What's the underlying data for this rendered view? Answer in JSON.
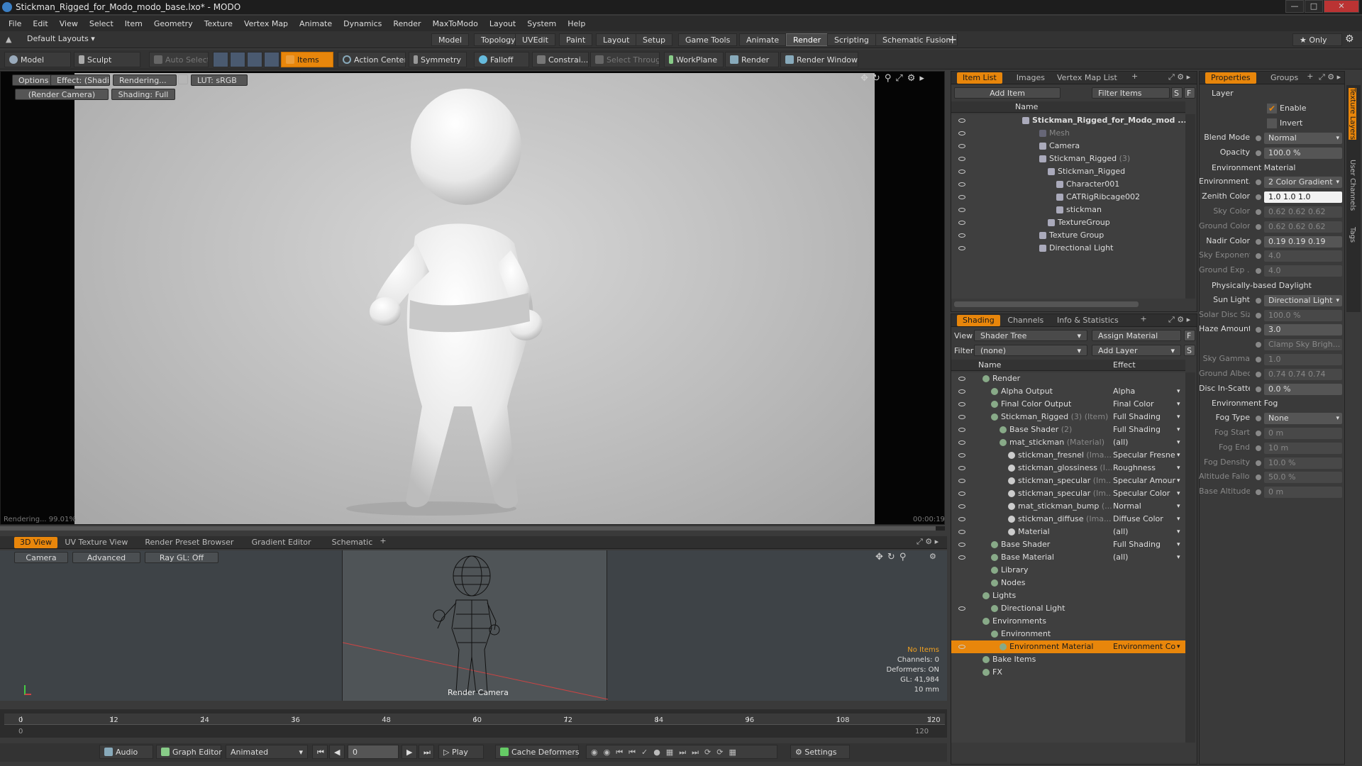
{
  "window": {
    "title": "Stickman_Rigged_for_Modo_modo_base.lxo* - MODO"
  },
  "menu": [
    "File",
    "Edit",
    "View",
    "Select",
    "Item",
    "Geometry",
    "Texture",
    "Vertex Map",
    "Animate",
    "Dynamics",
    "Render",
    "MaxToModo",
    "Layout",
    "System",
    "Help"
  ],
  "layouts": {
    "default": "Default Layouts ▾",
    "tabs": [
      "Model",
      "Topology",
      "UVEdit",
      "Paint",
      "Layout",
      "Setup",
      "Game Tools",
      "Animate",
      "Render",
      "Scripting",
      "Schematic Fusion"
    ],
    "active": "Render",
    "only": "★ Only"
  },
  "toolbar": {
    "model": "Model",
    "sculpt": "Sculpt",
    "auto_select": "Auto Select",
    "items": "Items",
    "action_center": "Action Center",
    "symmetry": "Symmetry",
    "falloff": "Falloff",
    "constrain": "Constrai...",
    "select_through": "Select Through",
    "workplane": "WorkPlane",
    "render": "Render",
    "render_window": "Render Window"
  },
  "viewport": {
    "options": "Options",
    "effect": "Effect: (Shadi...",
    "rendering": "Rendering...",
    "lut": "LUT: sRGB",
    "camera": "(Render Camera)",
    "shading": "Shading: Full",
    "status": "Rendering... 99.01%",
    "time": "00:00:19"
  },
  "lower_tabs": [
    "3D View",
    "UV Texture View",
    "Render Preset Browser",
    "Gradient Editor",
    "Schematic"
  ],
  "lower_view": {
    "camera": "Camera",
    "advanced": "Advanced",
    "raygl": "Ray GL: Off",
    "label": "Render Camera",
    "info": [
      "No Items",
      "Channels: 0",
      "Deformers: ON",
      "GL: 41,984",
      "10 mm"
    ]
  },
  "timeline": {
    "ticks": [
      "0",
      "12",
      "24",
      "36",
      "48",
      "60",
      "72",
      "84",
      "96",
      "108",
      "120"
    ],
    "sub": [
      "0",
      "120"
    ]
  },
  "bottom": {
    "audio": "Audio",
    "graph_editor": "Graph Editor",
    "animated": "Animated",
    "frame": "0",
    "play": "Play",
    "cache": "Cache Deformers",
    "settings": "Settings"
  },
  "item_list": {
    "tabs": [
      "Item List",
      "Images",
      "Vertex Map List"
    ],
    "add_item": "Add Item",
    "filter": "Filter Items",
    "s": "S",
    "f": "F",
    "col": "Name",
    "items": [
      {
        "t": "Stickman_Rigged_for_Modo_mod ...",
        "d": 0,
        "b": true
      },
      {
        "t": "Mesh",
        "d": 2,
        "g": true
      },
      {
        "t": "Camera",
        "d": 2
      },
      {
        "t": "Stickman_Rigged",
        "x": " (3)",
        "d": 2
      },
      {
        "t": "Stickman_Rigged",
        "d": 3
      },
      {
        "t": "Character001",
        "d": 4
      },
      {
        "t": "CATRigRibcage002",
        "d": 4
      },
      {
        "t": "stickman",
        "d": 4
      },
      {
        "t": "TextureGroup",
        "d": 3
      },
      {
        "t": "Texture Group",
        "d": 2
      },
      {
        "t": "Directional Light",
        "d": 2
      }
    ]
  },
  "shading": {
    "tabs": [
      "Shading",
      "Channels",
      "Info & Statistics"
    ],
    "view_label": "View",
    "view": "Shader Tree",
    "assign": "Assign Material",
    "filter_label": "Filter",
    "filter": "(none)",
    "add_layer": "Add Layer",
    "col_name": "Name",
    "col_effect": "Effect",
    "rows": [
      {
        "t": "Render",
        "e": "",
        "d": 0
      },
      {
        "t": "Alpha Output",
        "e": "Alpha",
        "d": 1
      },
      {
        "t": "Final Color Output",
        "e": "Final Color",
        "d": 1
      },
      {
        "t": "Stickman_Rigged",
        "x": " (3) (Item)",
        "e": "Full Shading",
        "d": 1
      },
      {
        "t": "Base Shader",
        "x": " (2)",
        "e": "Full Shading",
        "d": 2
      },
      {
        "t": "mat_stickman",
        "x": " (Material)",
        "e": "(all)",
        "d": 2
      },
      {
        "t": "stickman_fresnel",
        "x": " (Ima...",
        "e": "Specular Fresnel",
        "d": 3
      },
      {
        "t": "stickman_glossiness",
        "x": " (I...",
        "e": "Roughness",
        "d": 3
      },
      {
        "t": "stickman_specular",
        "x": " (Im...",
        "e": "Specular Amount",
        "d": 3
      },
      {
        "t": "stickman_specular",
        "x": " (Im...",
        "e": "Specular Color",
        "d": 3
      },
      {
        "t": "mat_stickman_bump",
        "x": " (...",
        "e": "Normal",
        "d": 3
      },
      {
        "t": "stickman_diffuse",
        "x": " (Ima...",
        "e": "Diffuse Color",
        "d": 3
      },
      {
        "t": "Material",
        "e": "(all)",
        "d": 3
      },
      {
        "t": "Base Shader",
        "e": "Full Shading",
        "d": 1
      },
      {
        "t": "Base Material",
        "e": "(all)",
        "d": 1
      },
      {
        "t": "Library",
        "e": "",
        "d": 1
      },
      {
        "t": "Nodes",
        "e": "",
        "d": 1
      },
      {
        "t": "Lights",
        "e": "",
        "d": 0
      },
      {
        "t": "Directional Light",
        "e": "",
        "d": 1
      },
      {
        "t": "Environments",
        "e": "",
        "d": 0
      },
      {
        "t": "Environment",
        "e": "",
        "d": 1
      },
      {
        "t": "Environment Material",
        "e": "Environment Color",
        "d": 2,
        "sel": true
      },
      {
        "t": "Bake Items",
        "e": "",
        "d": 0
      },
      {
        "t": "FX",
        "e": "",
        "d": 0
      }
    ]
  },
  "properties": {
    "tabs": [
      "Properties",
      "Groups"
    ],
    "side_tabs": [
      "Texture Layers",
      "User Channels",
      "Tags"
    ],
    "layer": "Layer",
    "enable": "Enable",
    "invert": "Invert",
    "rows": [
      {
        "l": "Blend Mode",
        "v": "Normal",
        "dd": true
      },
      {
        "l": "Opacity",
        "v": "100.0 %"
      },
      {
        "sec": "Environment Material"
      },
      {
        "l": "Environment...",
        "v": "2 Color Gradient",
        "dd": true
      },
      {
        "l": "Zenith Color",
        "v": "1.0      1.0      1.0",
        "w": true
      },
      {
        "l": "Sky Color",
        "v": "0.62   0.62   0.62",
        "dim": true
      },
      {
        "l": "Ground Color",
        "v": "0.62   0.62   0.62",
        "dim": true
      },
      {
        "l": "Nadir Color",
        "v": "0.19   0.19   0.19"
      },
      {
        "l": "Sky Exponent",
        "v": "4.0",
        "dim": true
      },
      {
        "l": "Ground Exp ...",
        "v": "4.0",
        "dim": true
      },
      {
        "sec": "Physically-based Daylight"
      },
      {
        "l": "Sun Light",
        "v": "Directional Light",
        "dd": true
      },
      {
        "l": "Solar Disc Size",
        "v": "100.0 %",
        "dim": true
      },
      {
        "l": "Haze Amount",
        "v": "3.0"
      },
      {
        "l": "",
        "v": "Clamp Sky Brigh...",
        "dim": true
      },
      {
        "l": "Sky Gamma",
        "v": "1.0",
        "dim": true
      },
      {
        "l": "Ground Albedo",
        "v": "0.74   0.74   0.74",
        "dim": true
      },
      {
        "l": "Disc In-Scatter",
        "v": "0.0 %"
      },
      {
        "sec": "Environment Fog"
      },
      {
        "l": "Fog Type",
        "v": "None",
        "dd": true
      },
      {
        "l": "Fog Start",
        "v": "0 m",
        "dim": true
      },
      {
        "l": "Fog End",
        "v": "10 m",
        "dim": true
      },
      {
        "l": "Fog Density",
        "v": "10.0 %",
        "dim": true
      },
      {
        "l": "Altitude Falloff",
        "v": "50.0 %",
        "dim": true
      },
      {
        "l": "Base Altitude",
        "v": "0 m",
        "dim": true
      }
    ]
  }
}
